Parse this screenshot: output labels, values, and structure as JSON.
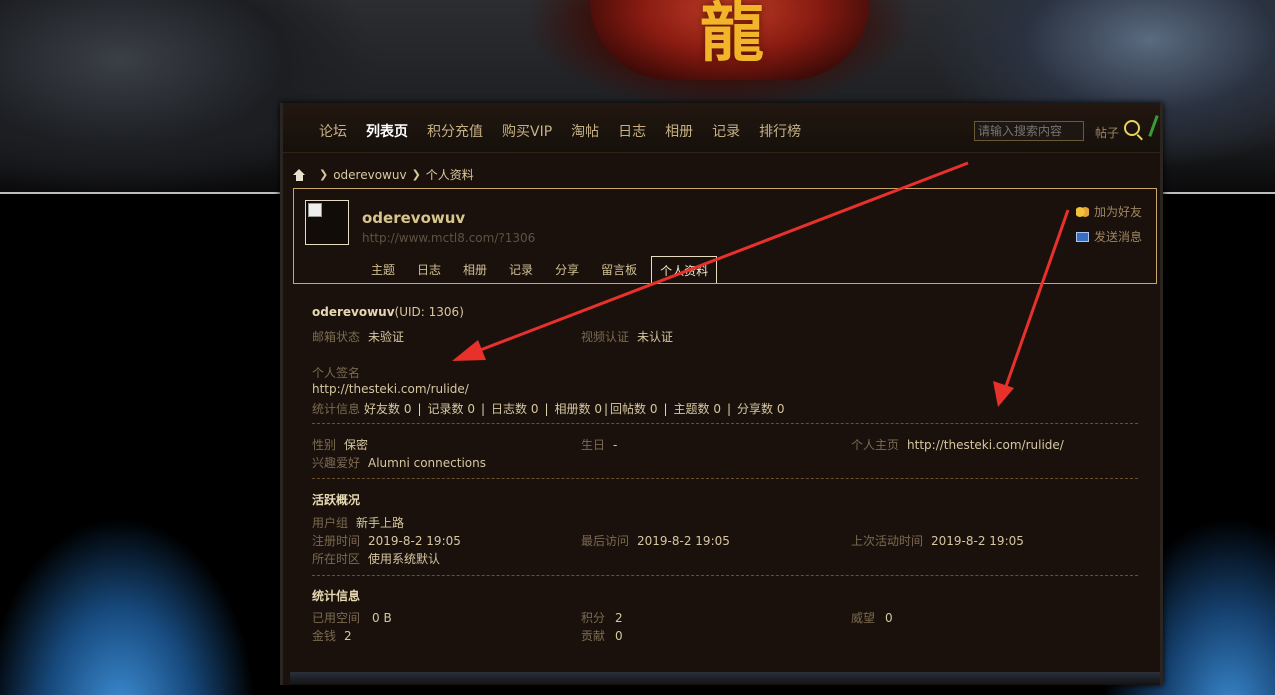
{
  "nav": {
    "items": [
      "论坛",
      "列表页",
      "积分充值",
      "购买VIP",
      "淘帖",
      "日志",
      "相册",
      "记录",
      "排行榜"
    ],
    "active_index": 1,
    "search_placeholder": "请输入搜索内容",
    "search_type": "帖子"
  },
  "breadcrumb": {
    "user": "oderevowuv",
    "page": "个人资料"
  },
  "profile": {
    "username": "oderevowuv",
    "url": "http://www.mctl8.com/?1306",
    "tabs": [
      "主题",
      "日志",
      "相册",
      "记录",
      "分享",
      "留言板",
      "个人资料"
    ],
    "active_tab_index": 6,
    "add_friend": "加为好友",
    "send_message": "发送消息"
  },
  "info": {
    "username": "oderevowuv",
    "uid_text": "(UID: 1306)",
    "email_status_label": "邮箱状态",
    "email_status": "未验证",
    "video_label": "视频认证",
    "video_status": "未认证",
    "signature_label": "个人签名",
    "signature": "http://thesteki.com/rulide/",
    "stats_label": "统计信息",
    "stats": [
      "好友数 0",
      "记录数 0",
      "日志数 0",
      "相册数 0",
      "回帖数 0",
      "主题数 0",
      "分享数 0"
    ],
    "gender_label": "性别",
    "gender": "保密",
    "birthday_label": "生日",
    "birthday": "-",
    "homepage_label": "个人主页",
    "homepage": "http://thesteki.com/rulide/",
    "hobby_label": "兴趣爱好",
    "hobby": "Alumni connections"
  },
  "activity": {
    "title": "活跃概况",
    "group_label": "用户组",
    "group": "新手上路",
    "reg_label": "注册时间",
    "reg": "2019-8-2 19:05",
    "last_visit_label": "最后访问",
    "last_visit": "2019-8-2 19:05",
    "last_active_label": "上次活动时间",
    "last_active": "2019-8-2 19:05",
    "tz_label": "所在时区",
    "tz": "使用系统默认"
  },
  "statistics": {
    "title": "统计信息",
    "space_label": "已用空间",
    "space": "0 B",
    "credits_label": "积分",
    "credits": "2",
    "prestige_label": "威望",
    "prestige": "0",
    "money_label": "金钱",
    "money": "2",
    "contrib_label": "贡献",
    "contrib": "0"
  },
  "colors": {
    "panel_bg": "#1a110c",
    "label": "#7b6a50",
    "value": "#d6c7a0",
    "border_gold": "#c9a56b",
    "annotation_red": "#e8312b"
  }
}
